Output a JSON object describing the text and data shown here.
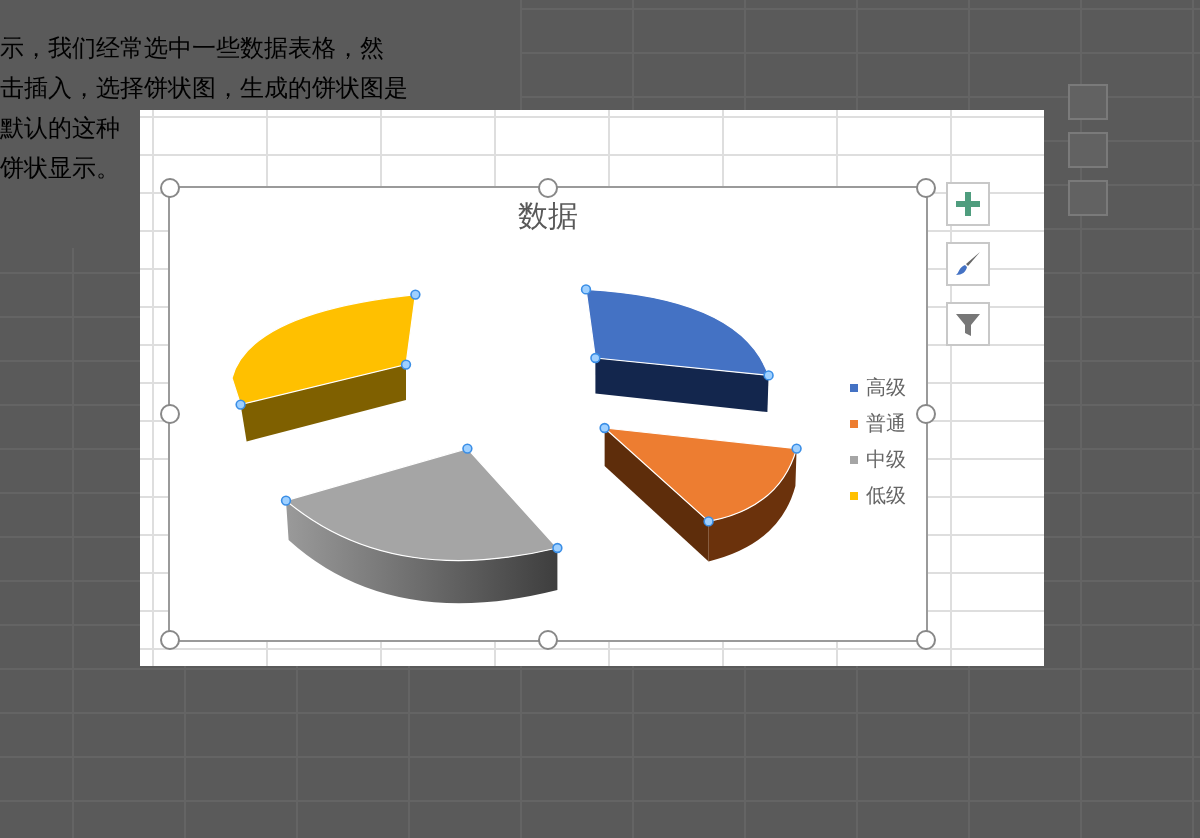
{
  "background_text": {
    "lines": [
      "示，我们经常选中一些数据表格，然",
      "击插入，选择饼状图，生成的饼状图是",
      "默认的这种",
      "饼状显示。"
    ]
  },
  "chart": {
    "title": "数据",
    "legend": [
      {
        "label": "高级",
        "color": "#4472c4"
      },
      {
        "label": "普通",
        "color": "#ed7d31"
      },
      {
        "label": "中级",
        "color": "#a5a5a5"
      },
      {
        "label": "低级",
        "color": "#ffc000"
      }
    ]
  },
  "chart_buttons": [
    {
      "kind": "add"
    },
    {
      "kind": "style"
    },
    {
      "kind": "filter"
    }
  ]
}
